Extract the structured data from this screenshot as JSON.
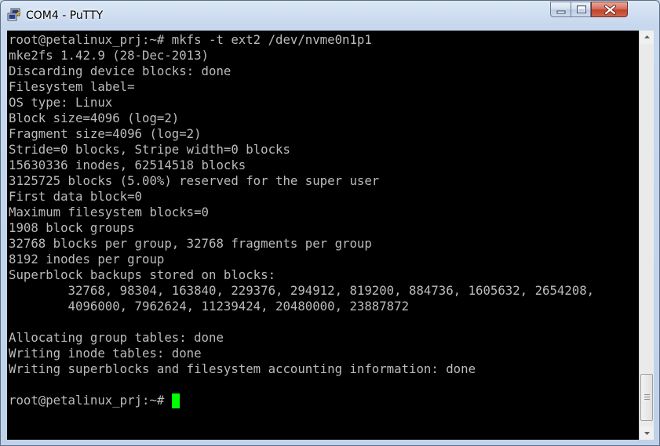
{
  "window": {
    "title": "COM4 - PuTTY"
  },
  "icons": {
    "app": "putty-terminal-icon",
    "minimize": "minimize-icon",
    "maximize": "maximize-icon",
    "close": "close-icon",
    "scroll_up": "scroll-up-arrow-icon",
    "scroll_down": "scroll-down-arrow-icon"
  },
  "colors": {
    "terminal_bg": "#000000",
    "terminal_fg": "#bbbbbb",
    "cursor": "#00ff00",
    "close_button": "#c7452f"
  },
  "terminal": {
    "lines": [
      "root@petalinux_prj:~# mkfs -t ext2 /dev/nvme0n1p1",
      "mke2fs 1.42.9 (28-Dec-2013)",
      "Discarding device blocks: done",
      "Filesystem label=",
      "OS type: Linux",
      "Block size=4096 (log=2)",
      "Fragment size=4096 (log=2)",
      "Stride=0 blocks, Stripe width=0 blocks",
      "15630336 inodes, 62514518 blocks",
      "3125725 blocks (5.00%) reserved for the super user",
      "First data block=0",
      "Maximum filesystem blocks=0",
      "1908 block groups",
      "32768 blocks per group, 32768 fragments per group",
      "8192 inodes per group",
      "Superblock backups stored on blocks:",
      "        32768, 98304, 163840, 229376, 294912, 819200, 884736, 1605632, 2654208,",
      "        4096000, 7962624, 11239424, 20480000, 23887872",
      "",
      "Allocating group tables: done",
      "Writing inode tables: done",
      "Writing superblocks and filesystem accounting information: done",
      "",
      "root@petalinux_prj:~# "
    ]
  }
}
